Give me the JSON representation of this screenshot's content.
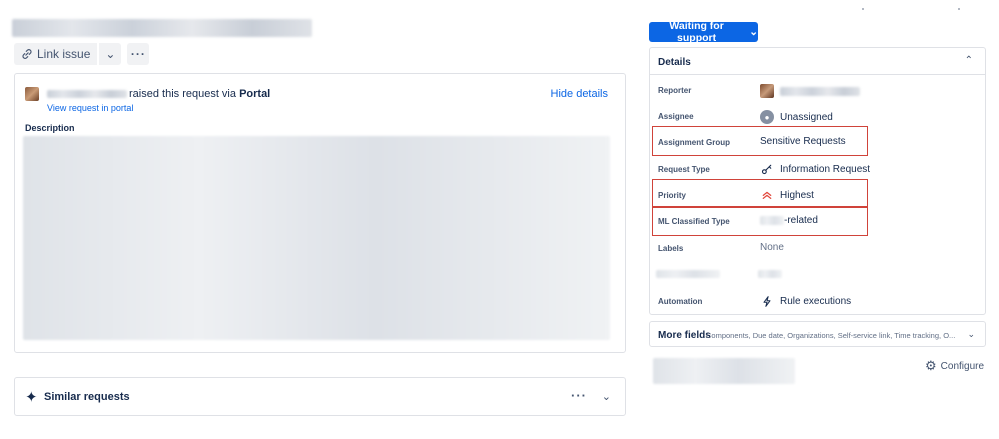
{
  "header": {
    "link_issue_label": "Link issue",
    "more_icon": "more-horizontal-icon"
  },
  "request": {
    "raised_prefix": "raised this request via",
    "channel": "Portal",
    "view_link": "View request in portal",
    "hide_details": "Hide details",
    "description_label": "Description"
  },
  "similar": {
    "label": "Similar requests"
  },
  "status": {
    "label": "Waiting for support",
    "color": "#0c66e4"
  },
  "details": {
    "title": "Details",
    "fields": {
      "reporter_label": "Reporter",
      "assignee_label": "Assignee",
      "assignee_value": "Unassigned",
      "assignment_group_label": "Assignment Group",
      "assignment_group_value": "Sensitive Requests",
      "request_type_label": "Request Type",
      "request_type_value": "Information Request",
      "priority_label": "Priority",
      "priority_value": "Highest",
      "ml_type_label": "ML Classified Type",
      "ml_type_value": "-related",
      "labels_label": "Labels",
      "labels_value": "None",
      "automation_label": "Automation",
      "automation_value": "Rule executions"
    },
    "highlight_color": "#d0433a",
    "priority_color": "#e2483d"
  },
  "more_fields": {
    "title": "More fields",
    "subtitle": "Components, Due date, Organizations, Self-service link, Time tracking, O..."
  },
  "configure": {
    "label": "Configure"
  }
}
